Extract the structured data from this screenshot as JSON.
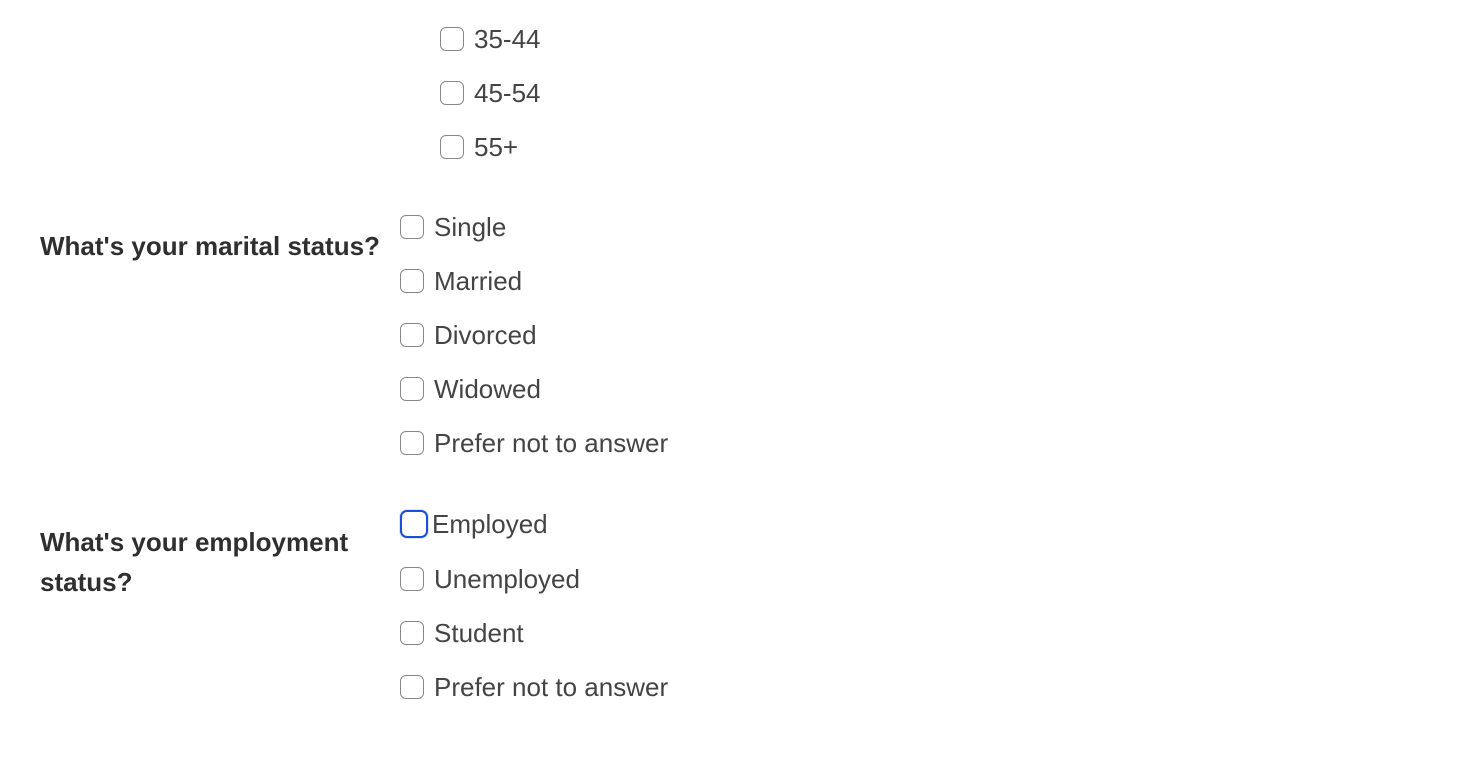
{
  "questions": {
    "age_partial": {
      "options": [
        "35-44",
        "45-54",
        "55+"
      ]
    },
    "marital": {
      "label": "What's your marital status?",
      "options": [
        "Single",
        "Married",
        "Divorced",
        "Widowed",
        "Prefer not to answer"
      ]
    },
    "employment": {
      "label": "What's your employment status?",
      "options": [
        "Employed",
        "Unemployed",
        "Student",
        "Prefer not to answer"
      ],
      "focused_index": 0
    }
  }
}
